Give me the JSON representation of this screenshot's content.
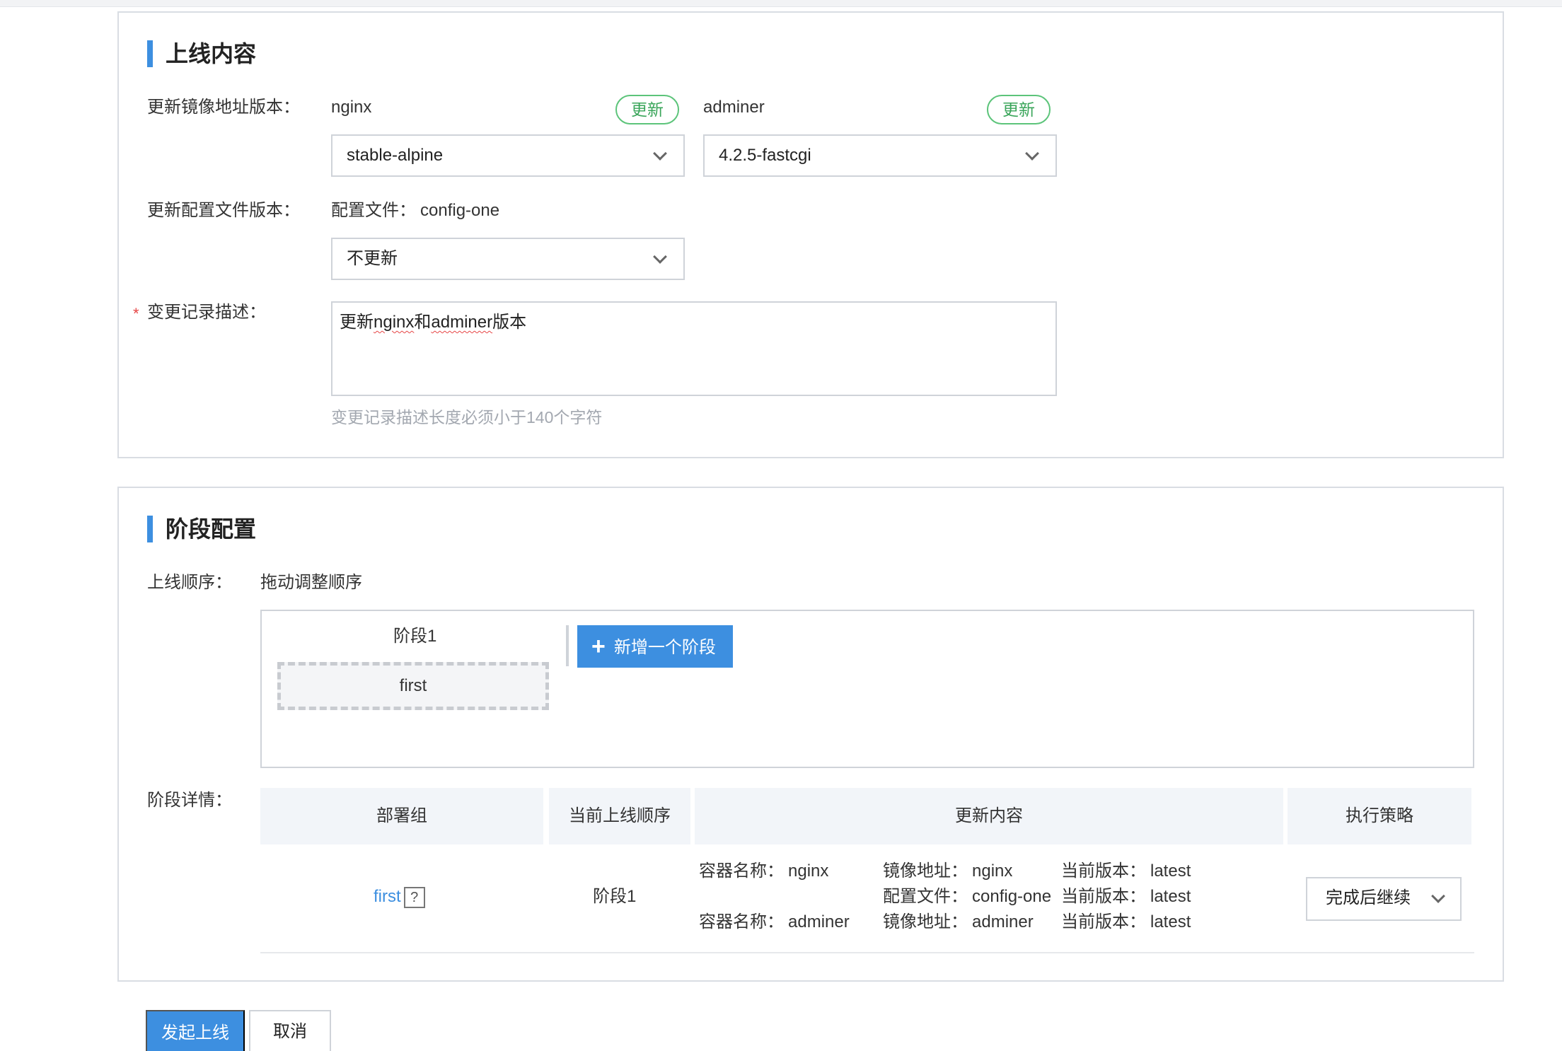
{
  "content_section": {
    "title": "上线内容",
    "image_label": "更新镜像地址版本：",
    "images": [
      {
        "name": "nginx",
        "update_label": "更新",
        "selected": "stable-alpine"
      },
      {
        "name": "adminer",
        "update_label": "更新",
        "selected": "4.2.5-fastcgi"
      }
    ],
    "config_label": "更新配置文件版本：",
    "config_file_prefix": "配置文件：",
    "config_file_name": "config-one",
    "config_selected": "不更新",
    "desc_required_mark": "*",
    "desc_label": "变更记录描述：",
    "desc_value_parts": [
      "更新",
      "nginx",
      "和",
      "adminer",
      "版本"
    ],
    "desc_hint": "变更记录描述长度必须小于140个字符"
  },
  "stage_section": {
    "title": "阶段配置",
    "order_label": "上线顺序：",
    "order_hint": "拖动调整顺序",
    "stage_title": "阶段1",
    "stage_item": "first",
    "add_stage_label": "新增一个阶段",
    "detail_label": "阶段详情：",
    "table_headers": [
      "部署组",
      "当前上线顺序",
      "更新内容",
      "执行策略"
    ],
    "row": {
      "group": "first",
      "help_mark": "?",
      "order": "阶段1",
      "containers": [
        {
          "name_label": "容器名称：",
          "name": "nginx",
          "image_label": "镜像地址：",
          "image": "nginx",
          "version_label": "当前版本：",
          "version": "latest",
          "config_label": "配置文件：",
          "config": "config-one",
          "config_version_label": "当前版本：",
          "config_version": "latest"
        },
        {
          "name_label": "容器名称：",
          "name": "adminer",
          "image_label": "镜像地址：",
          "image": "adminer",
          "version_label": "当前版本：",
          "version": "latest"
        }
      ],
      "strategy": "完成后继续"
    }
  },
  "actions": {
    "submit_label": "发起上线",
    "cancel_label": "取消"
  }
}
